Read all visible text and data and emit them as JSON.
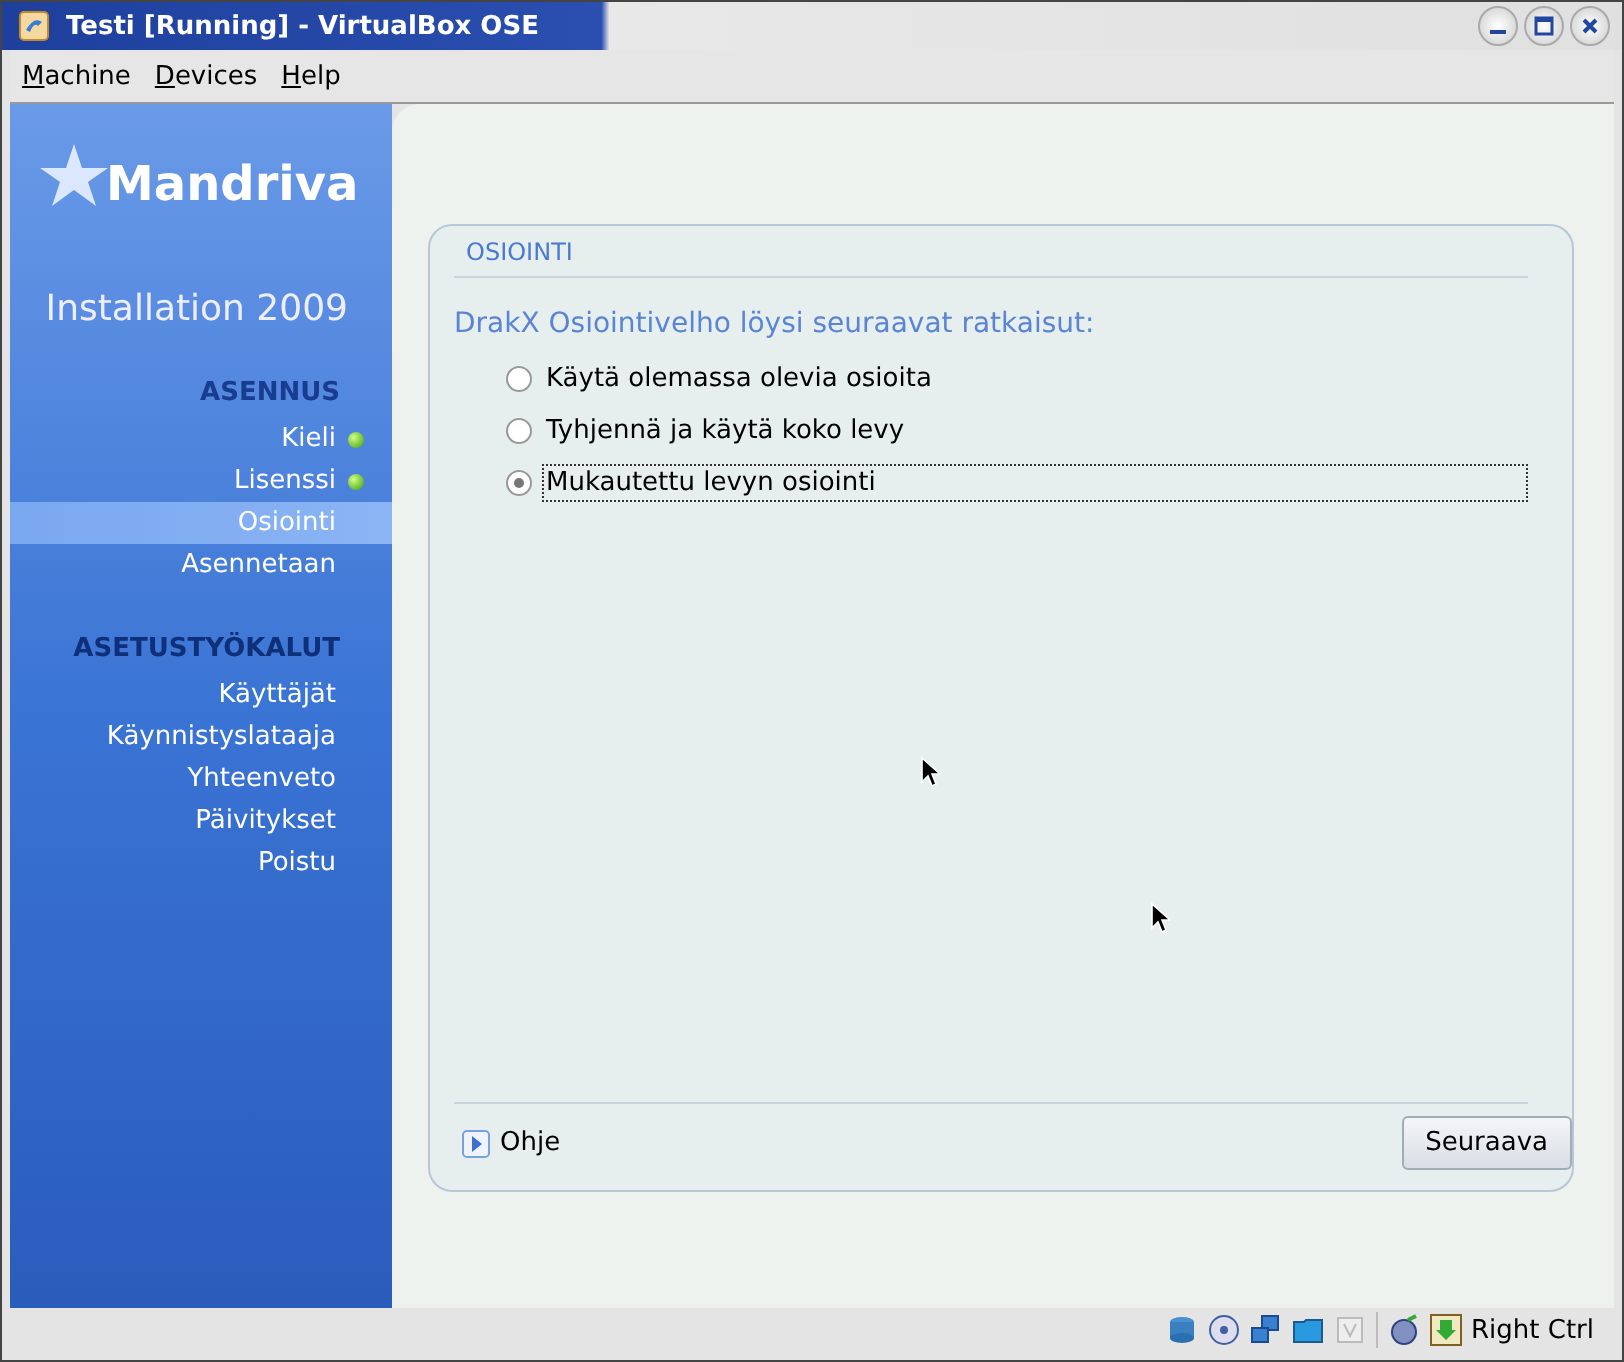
{
  "window": {
    "title": "Testi [Running] - VirtualBox OSE"
  },
  "menu": [
    "Machine",
    "Devices",
    "Help"
  ],
  "sidebar": {
    "logo": "Mandriva",
    "subtitle": "Installation 2009",
    "sections": [
      {
        "heading": "ASENNUS",
        "items": [
          {
            "label": "Kieli",
            "done": true,
            "selected": false
          },
          {
            "label": "Lisenssi",
            "done": true,
            "selected": false
          },
          {
            "label": "Osiointi",
            "done": false,
            "selected": true
          },
          {
            "label": "Asennetaan",
            "done": false,
            "selected": false
          }
        ]
      },
      {
        "heading": "ASETUSTYÖKALUT",
        "items": [
          {
            "label": "Käyttäjät",
            "done": false,
            "selected": false
          },
          {
            "label": "Käynnistyslataaja",
            "done": false,
            "selected": false
          },
          {
            "label": "Yhteenveto",
            "done": false,
            "selected": false
          },
          {
            "label": "Päivitykset",
            "done": false,
            "selected": false
          },
          {
            "label": "Poistu",
            "done": false,
            "selected": false
          }
        ]
      }
    ]
  },
  "panel": {
    "title": "OSIOINTI",
    "prompt": "DrakX Osiointivelho löysi seuraavat ratkaisut:",
    "options": [
      {
        "label": "Käytä olemassa olevia osioita",
        "selected": false
      },
      {
        "label": "Tyhjennä ja käytä koko levy",
        "selected": false
      },
      {
        "label": "Mukautettu levyn osiointi",
        "selected": true
      }
    ],
    "help": "Ohje",
    "next": "Seuraava"
  },
  "status_bar": {
    "host_key": "Right Ctrl"
  }
}
